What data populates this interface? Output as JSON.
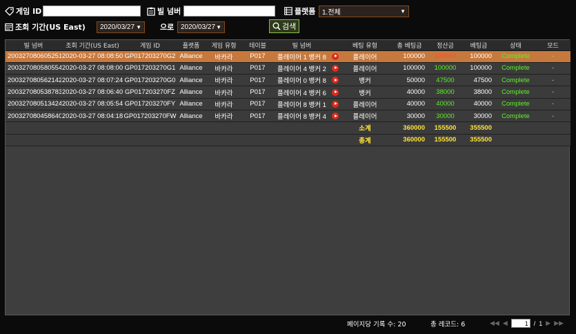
{
  "filters": {
    "game_id_label": "게임 ID",
    "game_id_value": "",
    "bill_no_label": "빌 넘버",
    "bill_no_value": "",
    "platform_label": "플랫폼",
    "platform_value": "1.전체",
    "period_label": "조회 기간(US East)",
    "date_from": "2020/03/27",
    "to_label": "으로",
    "date_to": "2020/03/27",
    "search_label": "검색"
  },
  "table": {
    "columns": [
      "빌 넘버",
      "조회 기간(US East)",
      "게임 ID",
      "플랫폼",
      "게임 유형",
      "테이블",
      "빌 넘버",
      "",
      "베팅 유형",
      "총 베팅금",
      "정산금",
      "베팅금",
      "상태",
      "모드"
    ],
    "rows": [
      {
        "bill": "200327080605251",
        "time": "2020-03-27 08:08:50",
        "game_id": "GP017203270G2",
        "platform": "Alliance",
        "game_type": "바카라",
        "table": "P017",
        "bill_desc": "플레이어 1 뱅커 8",
        "bet_type": "플레이어",
        "total_bet": "100000",
        "settle": "100000",
        "settle_color": "red",
        "bet": "100000",
        "status": "Complete",
        "mode": "-"
      },
      {
        "bill": "200327080580554",
        "time": "2020-03-27 08:08:00",
        "game_id": "GP017203270G1",
        "platform": "Alliance",
        "game_type": "바카라",
        "table": "P017",
        "bill_desc": "플레이어 4 뱅커 2",
        "bet_type": "플레이어",
        "total_bet": "100000",
        "settle": "100000",
        "settle_color": "green",
        "bet": "100000",
        "status": "Complete",
        "mode": "-"
      },
      {
        "bill": "200327080562142",
        "time": "2020-03-27 08:07:24",
        "game_id": "GP017203270G0",
        "platform": "Alliance",
        "game_type": "바카라",
        "table": "P017",
        "bill_desc": "플레이어 0 뱅커 8",
        "bet_type": "뱅커",
        "total_bet": "50000",
        "settle": "47500",
        "settle_color": "green",
        "bet": "47500",
        "status": "Complete",
        "mode": "-"
      },
      {
        "bill": "200327080538783",
        "time": "2020-03-27 08:06:40",
        "game_id": "GP017203270FZ",
        "platform": "Alliance",
        "game_type": "바카라",
        "table": "P017",
        "bill_desc": "플레이어 4 뱅커 6",
        "bet_type": "뱅커",
        "total_bet": "40000",
        "settle": "38000",
        "settle_color": "green",
        "bet": "38000",
        "status": "Complete",
        "mode": "-"
      },
      {
        "bill": "200327080513424",
        "time": "2020-03-27 08:05:54",
        "game_id": "GP017203270FY",
        "platform": "Alliance",
        "game_type": "바카라",
        "table": "P017",
        "bill_desc": "플레이어 8 뱅커 1",
        "bet_type": "플레이어",
        "total_bet": "40000",
        "settle": "40000",
        "settle_color": "green",
        "bet": "40000",
        "status": "Complete",
        "mode": "-"
      },
      {
        "bill": "200327080458640",
        "time": "2020-03-27 08:04:18",
        "game_id": "GP017203270FW",
        "platform": "Alliance",
        "game_type": "바카라",
        "table": "P017",
        "bill_desc": "플레이어 8 뱅커 4",
        "bet_type": "플레이어",
        "total_bet": "30000",
        "settle": "30000",
        "settle_color": "green",
        "bet": "30000",
        "status": "Complete",
        "mode": "-"
      }
    ],
    "subtotal": {
      "label": "소계",
      "total_bet": "360000",
      "settle": "155500",
      "bet": "355500"
    },
    "total": {
      "label": "총계",
      "total_bet": "360000",
      "settle": "155500",
      "bet": "355500"
    }
  },
  "footer": {
    "per_page": "페이지당 기록 수: 20",
    "total_records": "총 레코드: 6",
    "page_current": "1",
    "page_sep": "/",
    "page_total": "1"
  },
  "colors": {
    "selected_row": "#c7793d",
    "green": "#5df225",
    "red": "#ff4a2a",
    "yellow": "#ffe43a"
  }
}
